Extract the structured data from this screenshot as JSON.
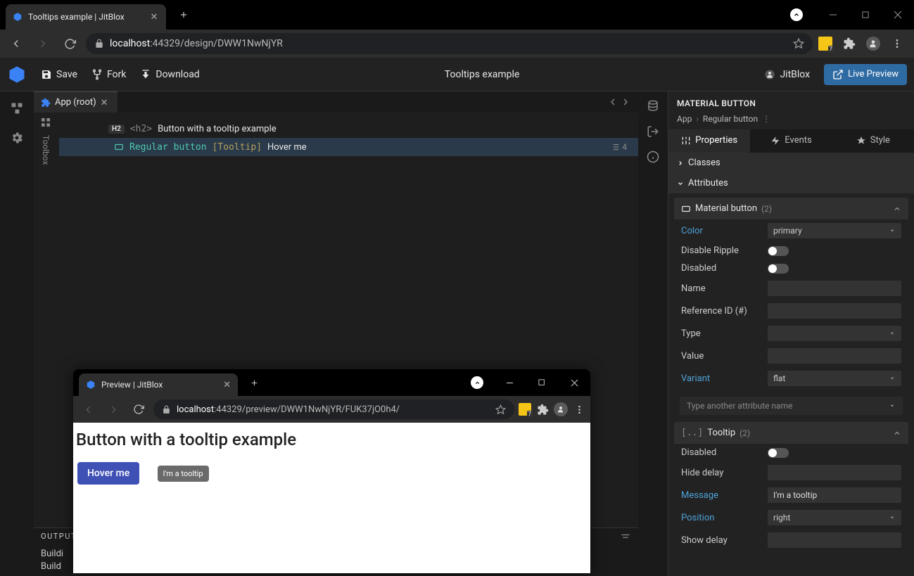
{
  "browser": {
    "tab_title": "Tooltips example | JitBlox",
    "url_host": "localhost",
    "url_port_path": ":44329/design/DWW1NwNjYR",
    "ext_badge": "7"
  },
  "toolbar": {
    "save": "Save",
    "fork": "Fork",
    "download": "Download",
    "project_title": "Tooltips example",
    "user": "JitBlox",
    "live_preview": "Live Preview"
  },
  "editor": {
    "toolbox_label": "Toolbox",
    "doc_tab": "App (root)",
    "rows": {
      "h2_tag": "H2",
      "h2_code": "<h2>",
      "h2_text": "Button with a tooltip example",
      "comp": "Regular button",
      "directive": "[Tooltip]",
      "btn_text": "Hover me",
      "count": "4"
    }
  },
  "output": {
    "title": "OUTPUT",
    "lines": [
      "Buildi",
      "Build "
    ]
  },
  "props": {
    "header": "MATERIAL BUTTON",
    "crumb_root": "App",
    "crumb_leaf": "Regular button",
    "tabs": {
      "properties": "Properties",
      "events": "Events",
      "style": "Style"
    },
    "sections": {
      "classes": "Classes",
      "attributes": "Attributes"
    },
    "group1": {
      "title": "Material button",
      "count": "(2)"
    },
    "attrs1": {
      "color": "Color",
      "color_val": "primary",
      "disable_ripple": "Disable Ripple",
      "disabled": "Disabled",
      "name": "Name",
      "ref_id": "Reference ID (#)",
      "type": "Type",
      "value": "Value",
      "variant": "Variant",
      "variant_val": "flat"
    },
    "add_attr_placeholder": "Type another attribute name",
    "group2": {
      "prefix": "[..]",
      "title": "Tooltip",
      "count": "(2)"
    },
    "attrs2": {
      "disabled": "Disabled",
      "hide_delay": "Hide delay",
      "message": "Message",
      "message_val": "I'm a tooltip",
      "position": "Position",
      "position_val": "right",
      "show_delay": "Show delay"
    }
  },
  "preview": {
    "tab_title": "Preview | JitBlox",
    "url_host": "localhost",
    "url_rest": ":44329/preview/DWW1NwNjYR/FUK37jO0h4/",
    "heading": "Button with a tooltip example",
    "button": "Hover me",
    "tooltip": "I'm a tooltip",
    "ext_badge": "7"
  }
}
